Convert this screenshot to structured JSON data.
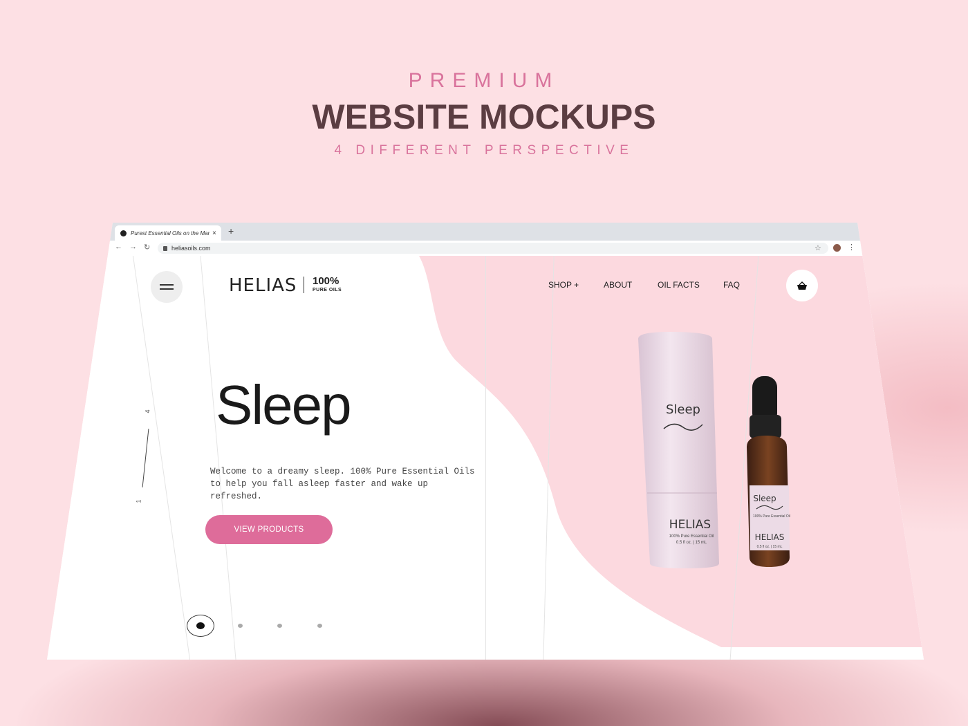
{
  "hero": {
    "eyebrow": "PREMIUM",
    "title": "WEBSITE MOCKUPS",
    "subtitle": "4 DIFFERENT PERSPECTIVE"
  },
  "browser": {
    "tab_title": "Purest Essential Oils on the Mark",
    "tab_close": "×",
    "new_tab": "+",
    "url": "heliasoils.com",
    "back": "←",
    "forward": "→",
    "reload": "↻",
    "star": "☆",
    "menu": "⋮"
  },
  "site": {
    "logo": "HELIAS",
    "logo_percent": "100%",
    "logo_sub": "PURE OILS",
    "nav": [
      "SHOP +",
      "ABOUT",
      "OIL FACTS",
      "FAQ"
    ],
    "heading": "Sleep",
    "description": "Welcome to a dreamy sleep. 100% Pure Essential Oils to help you fall asleep faster and wake up refreshed.",
    "cta": "VIEW PRODUCTS",
    "counter_top": "4",
    "counter_bottom": "1"
  },
  "product": {
    "tube_label": "Sleep",
    "tube_brand": "HELIAS",
    "tube_line1": "100% Pure Essential Oil",
    "tube_line2": "0.5 fl oz. | 15 mL",
    "bottle_label": "Sleep",
    "bottle_line1": "100% Pure Essential Oil",
    "bottle_brand": "HELIAS",
    "bottle_line2": "0.5 fl oz. | 15 mL"
  },
  "colors": {
    "background": "#fde0e4",
    "accent": "#de6c9a",
    "title": "#5b3d42",
    "page_pink": "#fcd9df"
  },
  "icons": [
    "menu-icon",
    "cart-icon",
    "lock-icon"
  ]
}
